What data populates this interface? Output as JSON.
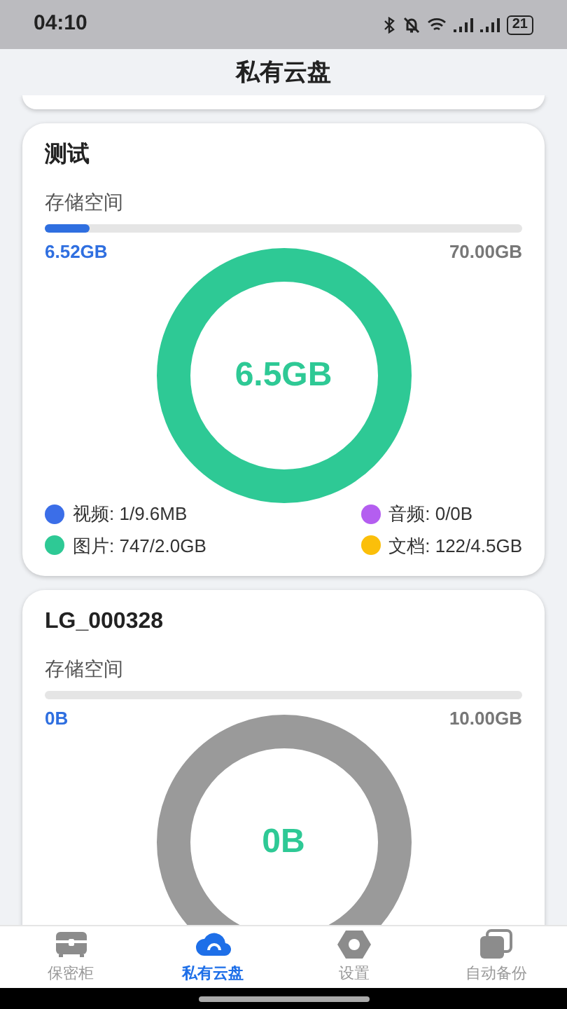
{
  "status_bar": {
    "time": "04:10",
    "battery": "21"
  },
  "header": {
    "title": "私有云盘"
  },
  "disks": [
    {
      "name": "测试",
      "storage_label": "存储空间",
      "level": 0.093,
      "used": "6.52GB",
      "total": "70.00GB",
      "center": "6.5GB",
      "legend": [
        {
          "label": "视频: 1/9.6MB",
          "color": "#3b6ee8"
        },
        {
          "label": "音频: 0/0B",
          "color": "#b45ef0"
        },
        {
          "label": "图片: 747/2.0GB",
          "color": "#2ec995"
        },
        {
          "label": "文档: 122/4.5GB",
          "color": "#fbbf0a"
        }
      ]
    },
    {
      "name": "LG_000328",
      "storage_label": "存储空间",
      "level": 0,
      "used": "0B",
      "total": "10.00GB",
      "center": "0B"
    }
  ],
  "tabs": [
    {
      "label": "保密柜",
      "kind": "safe",
      "selected": false
    },
    {
      "label": "私有云盘",
      "kind": "cloud",
      "selected": true
    },
    {
      "label": "设置",
      "kind": "settings",
      "selected": false
    },
    {
      "label": "自动备份",
      "kind": "backup",
      "selected": false
    }
  ]
}
